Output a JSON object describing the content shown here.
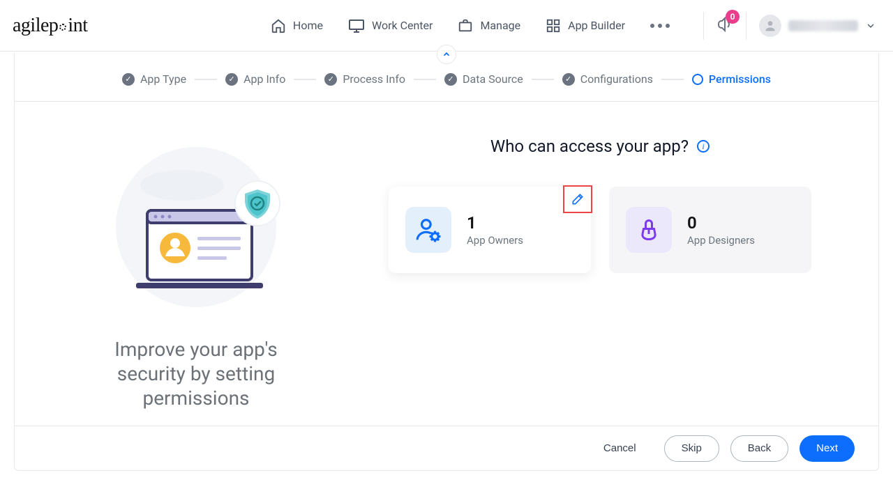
{
  "brand": "agilepoint",
  "nav": {
    "home": "Home",
    "workCenter": "Work Center",
    "manage": "Manage",
    "appBuilder": "App Builder"
  },
  "notifications": {
    "count": "0"
  },
  "stepper": {
    "items": [
      {
        "label": "App Type"
      },
      {
        "label": "App Info"
      },
      {
        "label": "Process Info"
      },
      {
        "label": "Data Source"
      },
      {
        "label": "Configurations"
      },
      {
        "label": "Permissions"
      }
    ]
  },
  "left": {
    "tagline": "Improve your app's security by setting permissions"
  },
  "main": {
    "title": "Who can access your app?",
    "tiles": {
      "owners": {
        "count": "1",
        "label": "App Owners"
      },
      "designers": {
        "count": "0",
        "label": "App Designers"
      }
    }
  },
  "footer": {
    "cancel": "Cancel",
    "skip": "Skip",
    "back": "Back",
    "next": "Next"
  }
}
